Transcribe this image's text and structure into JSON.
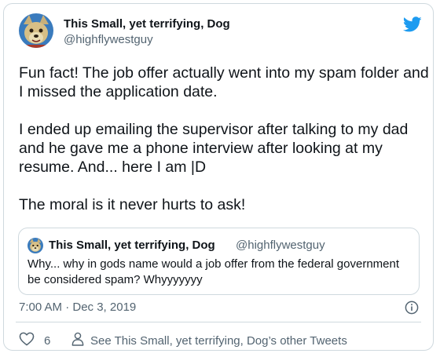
{
  "author": {
    "display_name": "This Small, yet terrifying, Dog",
    "handle": "@highflywestguy",
    "avatar_icon": "dog-avatar"
  },
  "brand": {
    "icon": "twitter-bird-icon",
    "color": "#1d9bf0"
  },
  "tweet": {
    "paragraphs": [
      [
        "Fun fact! The job offer actually went into my spam folder and",
        "I missed the application date."
      ],
      [
        "I ended up emailing the supervisor after talking to my dad",
        "and he gave me a phone interview after looking at my",
        "resume. And... here I am |D"
      ],
      [
        "The moral is it never hurts to ask!"
      ]
    ],
    "timestamp": "7:00 AM · Dec 3, 2019"
  },
  "quoted_tweet": {
    "display_name": "This Small, yet terrifying, Dog",
    "handle": "@highflywestguy",
    "lines": [
      "Why... why in gods name would a job offer from the federal government",
      "be considered spam? Whyyyyyyy"
    ]
  },
  "actions": {
    "like_count": "6",
    "other_tweets_label": "See This Small, yet terrifying, Dog’s other Tweets"
  }
}
